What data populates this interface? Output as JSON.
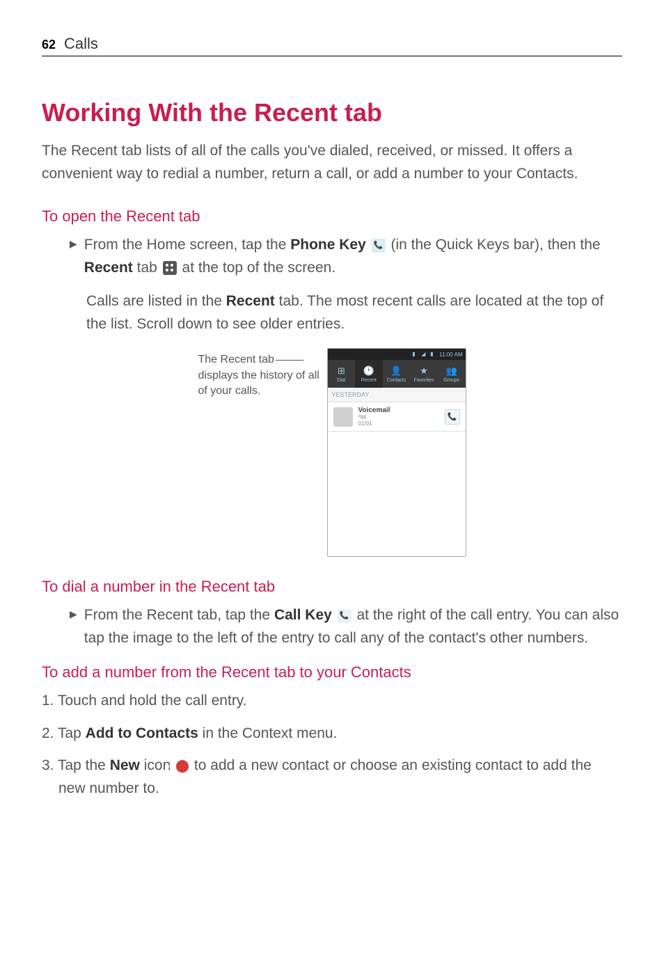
{
  "header": {
    "page_number": "62",
    "section_title": "Calls"
  },
  "title": "Working With the Recent tab",
  "intro": "The Recent tab lists of all of the calls you've dialed, received, or missed. It offers a convenient way to redial a number, return a call, or add a number to your Contacts.",
  "section1": {
    "heading": "To open the Recent tab",
    "bullet_pre": "From the Home screen, tap the ",
    "phone_key": "Phone Key",
    "bullet_mid": " (in the Quick Keys bar), then the ",
    "recent": "Recent",
    "bullet_end": " tab ",
    "bullet_tail": " at the top of the screen.",
    "continuation_pre": "Calls are listed in the ",
    "continuation_bold": "Recent",
    "continuation_end": " tab. The most recent calls are located at the top of the list. Scroll down to see older entries."
  },
  "figure": {
    "caption_l1": "The Recent tab",
    "caption_l2": "displays the history of all of your calls.",
    "status_time": "11:00 AM",
    "tabs": [
      "Dial",
      "Recent",
      "Contacts",
      "Favorites",
      "Groups"
    ],
    "day_label": "YESTERDAY",
    "entry_name": "Voicemail",
    "entry_sub1": "*86",
    "entry_sub2": "01/01"
  },
  "section2": {
    "heading": "To dial a number in the Recent tab",
    "bullet_pre": "From the Recent tab, tap the ",
    "call_key": "Call Key",
    "bullet_end": " at the right of the call entry. You can also tap the image to the left of the entry to call any of the contact's other numbers."
  },
  "section3": {
    "heading": "To add a number from the Recent tab to your Contacts",
    "item1": "1.  Touch and hold the call entry.",
    "item2_pre": "2.  Tap ",
    "item2_bold": "Add to Contacts",
    "item2_end": " in the Context menu.",
    "item3_pre": "3. Tap the ",
    "item3_bold": "New",
    "item3_mid": " icon ",
    "item3_end": " to add a new contact or choose an existing contact to add the new number to."
  }
}
